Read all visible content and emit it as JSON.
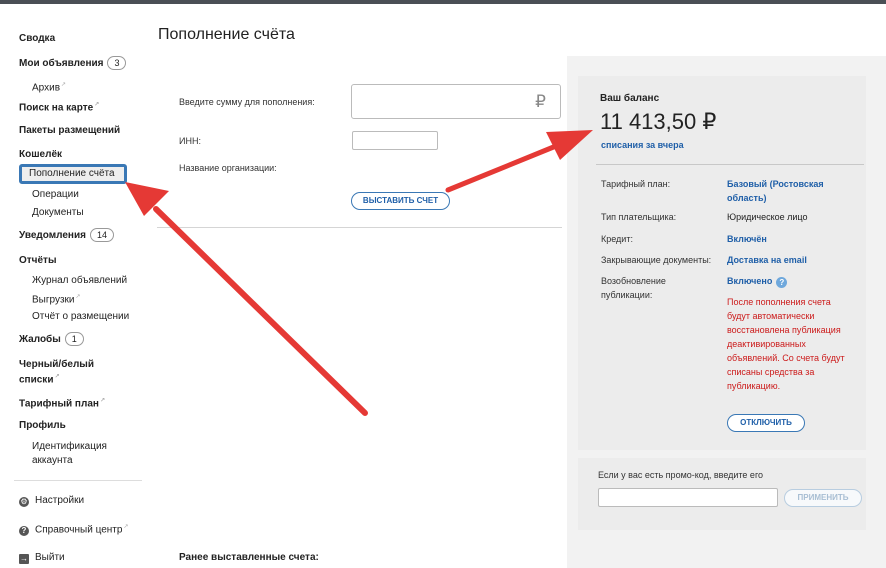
{
  "page": {
    "title": "Пополнение счёта"
  },
  "sidebar": {
    "svodka": "Сводка",
    "my_ads": "Мои объявления",
    "my_ads_count": "3",
    "archive": "Архив",
    "map_search": "Поиск на карте",
    "packages": "Пакеты размещений",
    "wallet": "Кошелёк",
    "topup": "Пополнение счёта",
    "operations": "Операции",
    "documents": "Документы",
    "notifications": "Уведомления",
    "notifications_count": "14",
    "reports": "Отчёты",
    "ad_journal": "Журнал объявлений",
    "exports": "Выгрузки",
    "placement_report": "Отчёт о размещении",
    "complaints": "Жалобы",
    "complaints_count": "1",
    "bw_lists_1": "Черный/белый",
    "bw_lists_2": "списки",
    "tariff": "Тарифный план",
    "profile": "Профиль",
    "ident_1": "Идентификация",
    "ident_2": "аккаунта",
    "settings": "Настройки",
    "help": "Справочный центр",
    "logout": "Выйти"
  },
  "form": {
    "amount_label": "Введите сумму для пополнения:",
    "currency": "₽",
    "inn_label": "ИНН:",
    "org_label": "Название организации:",
    "issue_button": "ВЫСТАВИТЬ СЧЕТ",
    "prev_invoices": "Ранее выставленные счета:"
  },
  "balance": {
    "title": "Ваш баланс",
    "amount": "11 413,50 ₽",
    "yesterday_link": "списания за вчера",
    "tariff_key": "Тарифный план:",
    "tariff_val_1": "Базовый (Ростовская",
    "tariff_val_2": "область)",
    "payer_key": "Тип плательщика:",
    "payer_val": "Юридическое лицо",
    "credit_key": "Кредит:",
    "credit_val": "Включён",
    "closing_docs_key": "Закрывающие документы:",
    "closing_docs_val": "Доставка на email",
    "renew_key_1": "Возобновление",
    "renew_key_2": "публикации:",
    "renew_val": "Включено",
    "warning": "После пополнения счета будут автоматически восстановлена публикация деактивированных объявлений. Со счета будут списаны средства за публикацию.",
    "disable_button": "ОТКЛЮЧИТЬ"
  },
  "promo": {
    "label": "Если у вас есть промо-код, введите его",
    "apply_button": "ПРИМЕНИТЬ"
  },
  "colors": {
    "accent": "#1f5fa8",
    "warning": "#cc1b1b",
    "arrow": "#e53935",
    "highlight": "#3a78b5"
  }
}
